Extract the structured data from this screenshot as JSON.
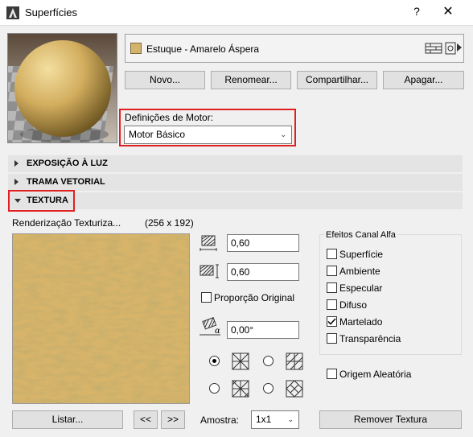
{
  "window": {
    "title": "Superfícies",
    "help": "?",
    "close": "✕"
  },
  "material": {
    "name": "Estuque - Amarelo Áspera",
    "swatch_color": "#d4b36b"
  },
  "buttons": {
    "new": "Novo...",
    "rename": "Renomear...",
    "share": "Compartilhar...",
    "delete": "Apagar..."
  },
  "engine": {
    "label": "Definições de Motor:",
    "selected": "Motor Básico"
  },
  "sections": {
    "light": "EXPOSIÇÃO À LUZ",
    "vector": "TRAMA VETORIAL",
    "texture": "TEXTURA"
  },
  "texture": {
    "name": "Renderização Texturiza...",
    "size": "(256 x 192)",
    "width": "0,60",
    "height": "0,60",
    "keep_proportion": "Proporção Original",
    "angle": "0,00°",
    "list_button": "Listar...",
    "prev": "<<",
    "next": ">>",
    "sample_label": "Amostra:",
    "sample_value": "1x1",
    "remove_button": "Remover Textura",
    "random_origin": "Origem Aleatória"
  },
  "alpha": {
    "title": "Efeitos Canal Alfa",
    "items": [
      {
        "label": "Superfície",
        "checked": false
      },
      {
        "label": "Ambiente",
        "checked": false
      },
      {
        "label": "Especular",
        "checked": false
      },
      {
        "label": "Difuso",
        "checked": false
      },
      {
        "label": "Martelado",
        "checked": true
      },
      {
        "label": "Transparência",
        "checked": false
      }
    ]
  },
  "colors": {
    "highlight": "#e02020",
    "texture_base": "#d7b46a"
  }
}
